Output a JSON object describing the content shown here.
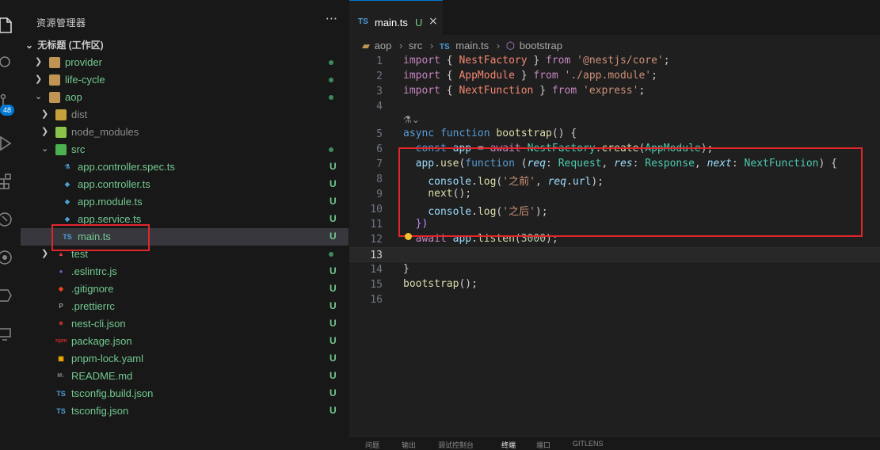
{
  "activity_bar": {
    "source_control_badge": "48"
  },
  "explorer": {
    "title": "资源管理器",
    "more": "···",
    "workspace": "无标题 (工作区)",
    "items": [
      {
        "label": "provider",
        "kind": "folder",
        "status": "dot",
        "expanded": false
      },
      {
        "label": "life-cycle",
        "kind": "folder",
        "status": "dot",
        "expanded": false
      },
      {
        "label": "aop",
        "kind": "folder",
        "status": "dot",
        "expanded": true
      },
      {
        "label": "dist",
        "kind": "folder",
        "status": "",
        "expanded": false
      },
      {
        "label": "node_modules",
        "kind": "folder",
        "status": "",
        "expanded": false
      },
      {
        "label": "src",
        "kind": "folder",
        "status": "dot",
        "expanded": true
      },
      {
        "label": "app.controller.spec.ts",
        "kind": "file",
        "status": "U"
      },
      {
        "label": "app.controller.ts",
        "kind": "file",
        "status": "U"
      },
      {
        "label": "app.module.ts",
        "kind": "file",
        "status": "U"
      },
      {
        "label": "app.service.ts",
        "kind": "file",
        "status": "U"
      },
      {
        "label": "main.ts",
        "kind": "file",
        "status": "U"
      },
      {
        "label": "test",
        "kind": "folder",
        "status": "dot",
        "expanded": false
      },
      {
        "label": ".eslintrc.js",
        "kind": "file",
        "status": "U"
      },
      {
        "label": ".gitignore",
        "kind": "file",
        "status": "U"
      },
      {
        "label": ".prettierrc",
        "kind": "file",
        "status": "U"
      },
      {
        "label": "nest-cli.json",
        "kind": "file",
        "status": "U"
      },
      {
        "label": "package.json",
        "kind": "file",
        "status": "U"
      },
      {
        "label": "pnpm-lock.yaml",
        "kind": "file",
        "status": "U"
      },
      {
        "label": "README.md",
        "kind": "file",
        "status": "U"
      },
      {
        "label": "tsconfig.build.json",
        "kind": "file",
        "status": "U"
      },
      {
        "label": "tsconfig.json",
        "kind": "file",
        "status": "U"
      }
    ]
  },
  "editor": {
    "tab": {
      "lang": "TS",
      "name": "main.ts",
      "status": "U",
      "close": "×"
    },
    "breadcrumb": [
      "aop",
      "src",
      "main.ts",
      "bootstrap"
    ],
    "line_numbers": [
      "1",
      "2",
      "3",
      "4",
      "5",
      "6",
      "7",
      "8",
      "9",
      "10",
      "11",
      "12",
      "13",
      "14",
      "15",
      "16"
    ],
    "code": {
      "l1": "import { NestFactory } from '@nestjs/core';",
      "l2": "import { AppModule } from './app.module';",
      "l3": "import { NextFunction } from 'express';",
      "l5": "async function bootstrap() {",
      "l6": "  const app = await NestFactory.create(AppModule);",
      "l7": "  app.use(function (req: Request, res: Response, next: NextFunction) {",
      "l8": "    console.log('之前', req.url);",
      "l9": "    next();",
      "l10": "    console.log('之后');",
      "l11": "  })",
      "l12": "  await app.listen(3000);",
      "l14": "}",
      "l15": "bootstrap();"
    },
    "cursor_line": "13"
  },
  "panel_tabs": [
    "问题",
    "输出",
    "调试控制台",
    "终端",
    "端口",
    "GITLENS"
  ]
}
